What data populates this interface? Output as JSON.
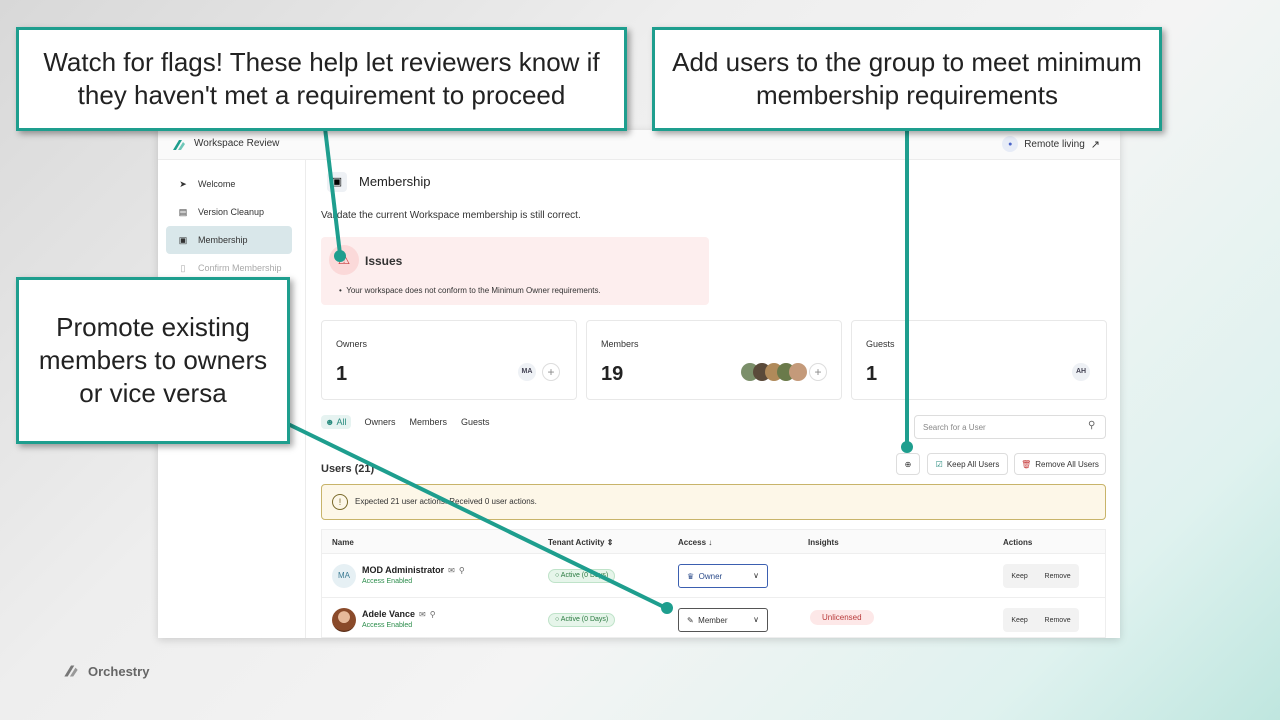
{
  "callouts": {
    "flags": "Watch for flags!  These help let reviewers know if they haven't met a requirement to proceed",
    "add_users": "Add users to the group to meet minimum membership requirements",
    "promote": "Promote existing members to owners or vice versa"
  },
  "app": {
    "title": "Workspace Review",
    "workspace_name": "Remote living"
  },
  "sidebar": {
    "items": [
      {
        "label": "Welcome",
        "icon": "rocket-icon"
      },
      {
        "label": "Version Cleanup",
        "icon": "document-icon"
      },
      {
        "label": "Membership",
        "icon": "person-card-icon"
      },
      {
        "label": "Confirm Membership",
        "icon": "bookmark-icon"
      }
    ]
  },
  "main": {
    "title": "Membership",
    "subtitle": "Validate the current Workspace membership is still correct.",
    "issues": {
      "title": "Issues",
      "items": [
        "Your workspace does not conform to the Minimum Owner requirements."
      ]
    },
    "cards": {
      "owners": {
        "label": "Owners",
        "count": "1",
        "avatar": "MA"
      },
      "members": {
        "label": "Members",
        "count": "19"
      },
      "guests": {
        "label": "Guests",
        "count": "1",
        "avatar": "AH"
      }
    },
    "filters": [
      "All",
      "Owners",
      "Members",
      "Guests"
    ],
    "search_placeholder": "Search for a User",
    "users_title": "Users (21)",
    "buttons": {
      "keep_all": "Keep All Users",
      "remove_all": "Remove All Users"
    },
    "warning": "Expected 21 user actions. Received 0 user actions.",
    "table": {
      "headers": [
        "Name",
        "Tenant Activity",
        "Access",
        "Insights",
        "Actions"
      ],
      "rows": [
        {
          "initials": "MA",
          "name": "MOD Administrator",
          "status": "Access Enabled",
          "activity": "Active (0 Days)",
          "access": "Owner",
          "insight": "",
          "keep": "Keep",
          "remove": "Remove"
        },
        {
          "initials": "",
          "name": "Adele Vance",
          "status": "Access Enabled",
          "activity": "Active (0 Days)",
          "access": "Member",
          "insight": "Unlicensed",
          "keep": "Keep",
          "remove": "Remove"
        }
      ]
    }
  },
  "brand": "Orchestry",
  "colors": {
    "accent": "#1e9e8e",
    "danger": "#c63b3b",
    "warning_border": "#c8b46a"
  }
}
